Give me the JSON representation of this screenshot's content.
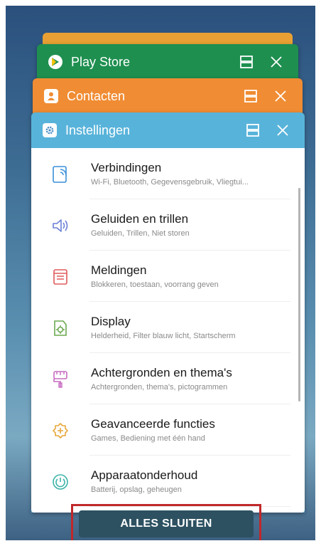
{
  "recents": {
    "cards": [
      {
        "app": "Play Store",
        "color": "#1e8f4f",
        "icon": "play-store-icon"
      },
      {
        "app": "Contacten",
        "color": "#f08c33",
        "icon": "contacts-icon"
      },
      {
        "app": "Instellingen",
        "color": "#58b3da",
        "icon": "settings-gear-icon"
      }
    ],
    "settings_items": [
      {
        "title": "Verbindingen",
        "subtitle": "Wi-Fi, Bluetooth, Gegevensgebruik, Vliegtui...",
        "icon": "connections-icon",
        "color": "#3a8fd9"
      },
      {
        "title": "Geluiden en trillen",
        "subtitle": "Geluiden, Trillen, Niet storen",
        "icon": "sound-icon",
        "color": "#6b7fd6"
      },
      {
        "title": "Meldingen",
        "subtitle": "Blokkeren, toestaan, voorrang geven",
        "icon": "notifications-icon",
        "color": "#e05a5a"
      },
      {
        "title": "Display",
        "subtitle": "Helderheid, Filter blauw licht, Startscherm",
        "icon": "display-icon",
        "color": "#6aa84f"
      },
      {
        "title": "Achtergronden en thema's",
        "subtitle": "Achtergronden, thema's, pictogrammen",
        "icon": "wallpaper-icon",
        "color": "#c76ac0"
      },
      {
        "title": "Geavanceerde functies",
        "subtitle": "Games, Bediening met één hand",
        "icon": "advanced-features-icon",
        "color": "#e8a63a"
      },
      {
        "title": "Apparaatonderhoud",
        "subtitle": "Batterij, opslag, geheugen",
        "icon": "device-maintenance-icon",
        "color": "#3cb3a8"
      }
    ],
    "close_all_label": "ALLES SLUITEN"
  }
}
